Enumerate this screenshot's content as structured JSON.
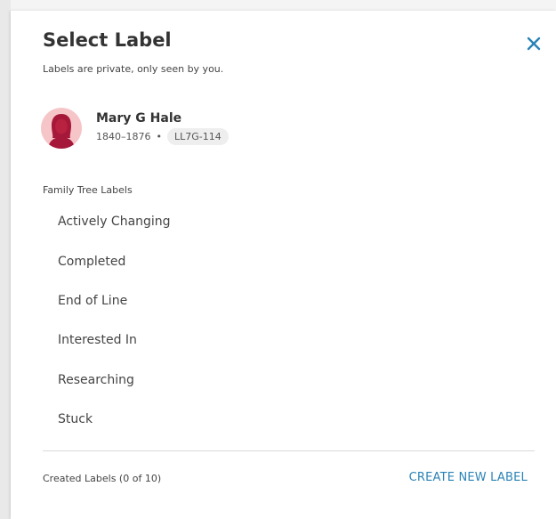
{
  "dialog": {
    "title": "Select Label",
    "subtitle": "Labels are private, only seen by you.",
    "close_icon": "close-icon"
  },
  "person": {
    "name": "Mary G Hale",
    "lifespan": "1840–1876",
    "separator": "•",
    "pid": "LL7G-114",
    "avatar_icon": "female-avatar-icon"
  },
  "family_tree_labels": {
    "heading": "Family Tree Labels",
    "items": [
      {
        "label": "Actively Changing"
      },
      {
        "label": "Completed"
      },
      {
        "label": "End of Line"
      },
      {
        "label": "Interested In"
      },
      {
        "label": "Researching"
      },
      {
        "label": "Stuck"
      }
    ]
  },
  "created_labels": {
    "count_text": "Created Labels (0 of 10)",
    "create_button_label": "CREATE NEW LABEL"
  },
  "colors": {
    "accent": "#2b83b6",
    "avatar_bg": "#f6c5c8",
    "avatar_figure": "#a5183a"
  }
}
